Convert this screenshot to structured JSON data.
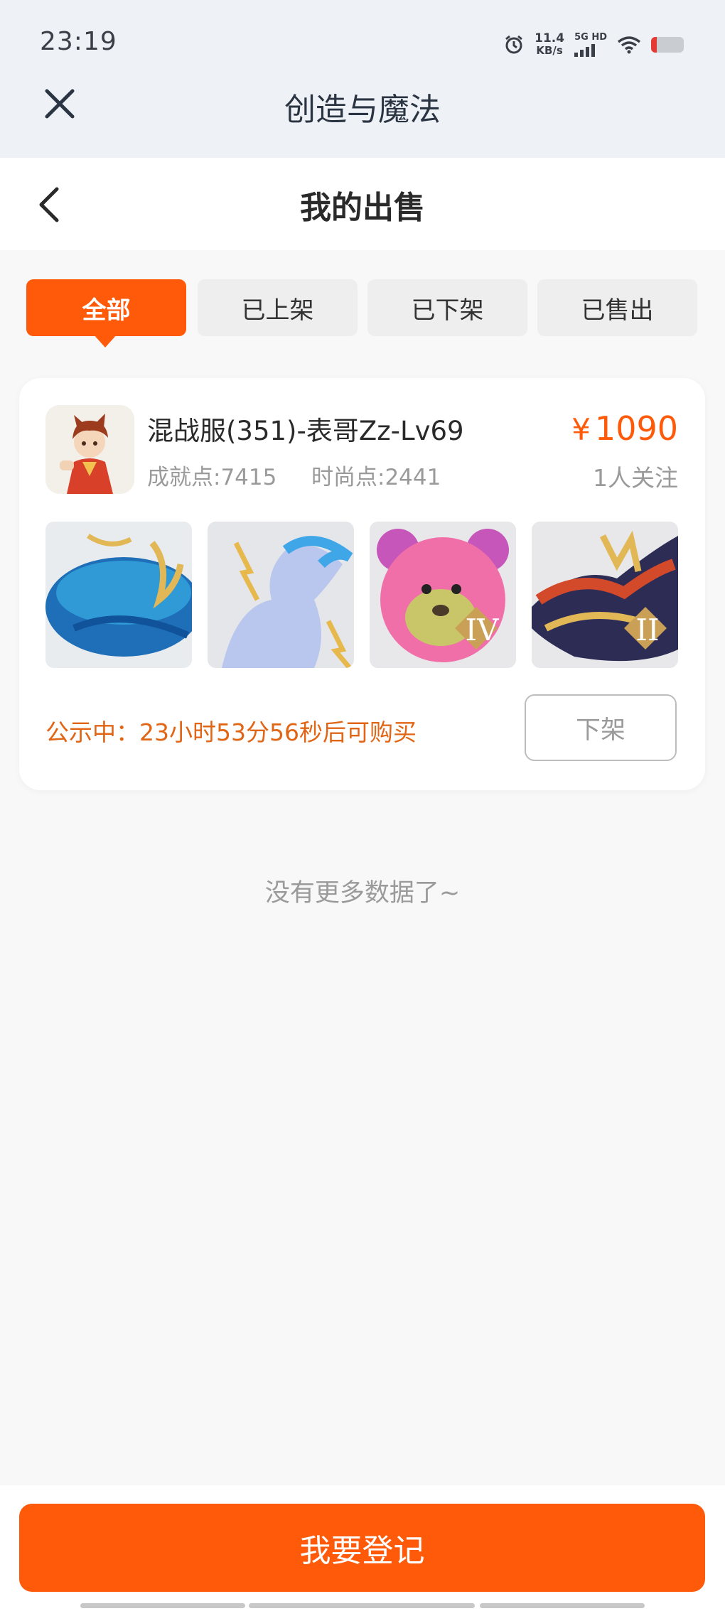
{
  "status_bar": {
    "time": "23:19",
    "net_speed_value": "11.4",
    "net_speed_unit": "KB/s",
    "signal_label": "5G HD",
    "icons": [
      "alarm-icon",
      "signal-icon",
      "wifi-icon",
      "battery-icon"
    ]
  },
  "app": {
    "title": "创造与魔法",
    "close_icon": "close-icon"
  },
  "page": {
    "title": "我的出售",
    "back_icon": "back-chevron-icon"
  },
  "tabs": [
    {
      "label": "全部",
      "active": true
    },
    {
      "label": "已上架",
      "active": false
    },
    {
      "label": "已下架",
      "active": false
    },
    {
      "label": "已售出",
      "active": false
    }
  ],
  "listing": {
    "title": "混战服(351)-表哥Zz-Lv69",
    "achievement": "成就点:7415",
    "fashion": "时尚点:2441",
    "currency": "¥",
    "price": "1090",
    "followers": "1人关注",
    "items": [
      {
        "name": "blue-whale-mount",
        "badge": ""
      },
      {
        "name": "spirit-horse-mount",
        "badge": ""
      },
      {
        "name": "pink-bear-outfit",
        "badge": "IV"
      },
      {
        "name": "fire-dragon-mount",
        "badge": "II"
      }
    ],
    "notice": "公示中：23小时53分56秒后可购买",
    "delist_label": "下架"
  },
  "no_more": "没有更多数据了~",
  "register_button": "我要登记",
  "colors": {
    "accent": "#ff5a0a",
    "notice": "#e06515"
  }
}
